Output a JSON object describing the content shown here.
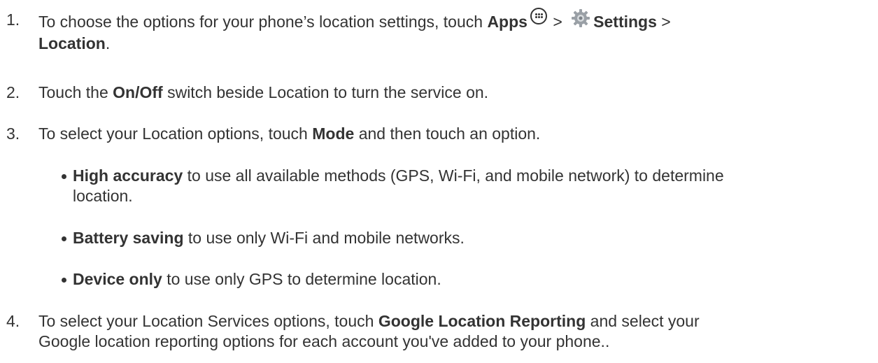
{
  "steps": [
    {
      "number": "1.",
      "line1_pre": "To choose the options for your phone’s location settings, touch ",
      "apps": "Apps",
      "gt1": " > ",
      "settings": "Settings",
      "gt2": " >",
      "location": "Location",
      "period": "."
    },
    {
      "number": "2.",
      "pre": "Touch the ",
      "bold": "On/Off",
      "post": " switch beside Location to turn the service on."
    },
    {
      "number": "3.",
      "pre": "To select your Location options, touch ",
      "bold": "Mode",
      "post": " and then touch an option."
    },
    {
      "number": "4.",
      "pre": "To select your Location Services options, touch ",
      "bold": "Google Location Reporting",
      "post": " and select your",
      "line2": "Google location reporting options for each account you've added to your phone.."
    }
  ],
  "mode_options": [
    {
      "bold": "High accuracy",
      "text": " to use all available methods (GPS, Wi-Fi, and mobile network) to determine",
      "line2": "location."
    },
    {
      "bold": "Battery saving",
      "text": " to use only Wi-Fi and mobile networks."
    },
    {
      "bold": "Device only",
      "text": " to use only GPS to determine location."
    }
  ],
  "icons": {
    "apps": "apps-icon",
    "settings": "settings-gear-icon"
  },
  "colors": {
    "text": "#333333",
    "background": "#ffffff",
    "gear": "#9aa0a6"
  }
}
